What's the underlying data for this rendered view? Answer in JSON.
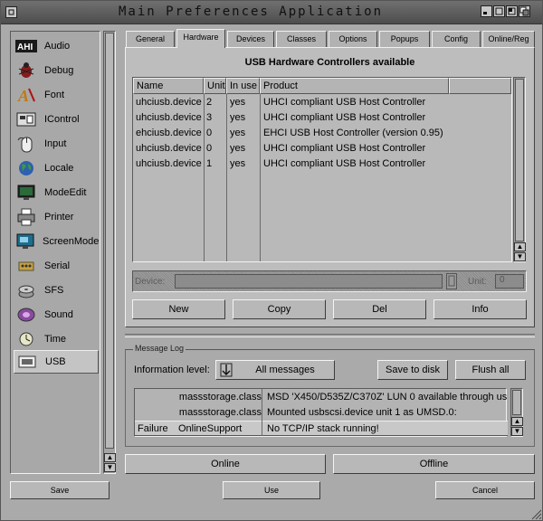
{
  "window": {
    "title": "Main Preferences Application"
  },
  "sidebar": {
    "items": [
      {
        "label": "Audio",
        "icon": "ahi-audio-icon"
      },
      {
        "label": "Debug",
        "icon": "bug-icon"
      },
      {
        "label": "Font",
        "icon": "font-icon"
      },
      {
        "label": "IControl",
        "icon": "icontrol-icon"
      },
      {
        "label": "Input",
        "icon": "mouse-icon"
      },
      {
        "label": "Locale",
        "icon": "globe-icon"
      },
      {
        "label": "ModeEdit",
        "icon": "monitor-icon"
      },
      {
        "label": "Printer",
        "icon": "printer-icon"
      },
      {
        "label": "ScreenMode",
        "icon": "screen-icon"
      },
      {
        "label": "Serial",
        "icon": "serial-icon"
      },
      {
        "label": "SFS",
        "icon": "disk-icon"
      },
      {
        "label": "Sound",
        "icon": "speaker-icon"
      },
      {
        "label": "Time",
        "icon": "clock-icon"
      },
      {
        "label": "USB",
        "icon": "usb-icon"
      }
    ],
    "selected": "USB"
  },
  "tabs": [
    "General",
    "Hardware",
    "Devices",
    "Classes",
    "Options",
    "Popups",
    "Config",
    "Online/Reg"
  ],
  "active_tab": "Hardware",
  "hardware": {
    "title": "USB Hardware Controllers available",
    "columns": [
      "Name",
      "Unit",
      "In use",
      "Product"
    ],
    "rows": [
      {
        "name": "uhciusb.device",
        "unit": "2",
        "in_use": "yes",
        "product": "UHCI compliant USB Host Controller"
      },
      {
        "name": "uhciusb.device",
        "unit": "3",
        "in_use": "yes",
        "product": "UHCI compliant USB Host Controller"
      },
      {
        "name": "ehciusb.device",
        "unit": "0",
        "in_use": "yes",
        "product": "EHCI USB Host Controller (version 0.95)"
      },
      {
        "name": "uhciusb.device",
        "unit": "0",
        "in_use": "yes",
        "product": "UHCI compliant USB Host Controller"
      },
      {
        "name": "uhciusb.device",
        "unit": "1",
        "in_use": "yes",
        "product": "UHCI compliant USB Host Controller"
      }
    ],
    "device_label": "Device:",
    "unit_label": "Unit:",
    "unit_value": "0",
    "buttons": {
      "new": "New",
      "copy": "Copy",
      "del": "Del",
      "info": "Info"
    }
  },
  "message_log": {
    "legend": "Message Log",
    "info_level_label": "Information level:",
    "info_level_value": "All messages",
    "save_to_disk": "Save to disk",
    "flush_all": "Flush all",
    "rows": [
      {
        "level": "",
        "source": "massstorage.class",
        "message": "MSD 'X450/D535Z/C370Z' LUN 0 available through us"
      },
      {
        "level": "",
        "source": "massstorage.class",
        "message": "Mounted usbscsi.device unit 1 as UMSD.0:"
      },
      {
        "level": "Failure",
        "source": "OnlineSupport",
        "message": "No TCP/IP stack running!"
      }
    ]
  },
  "online_button": "Online",
  "offline_button": "Offline",
  "bottom_buttons": {
    "save": "Save",
    "use": "Use",
    "cancel": "Cancel"
  }
}
